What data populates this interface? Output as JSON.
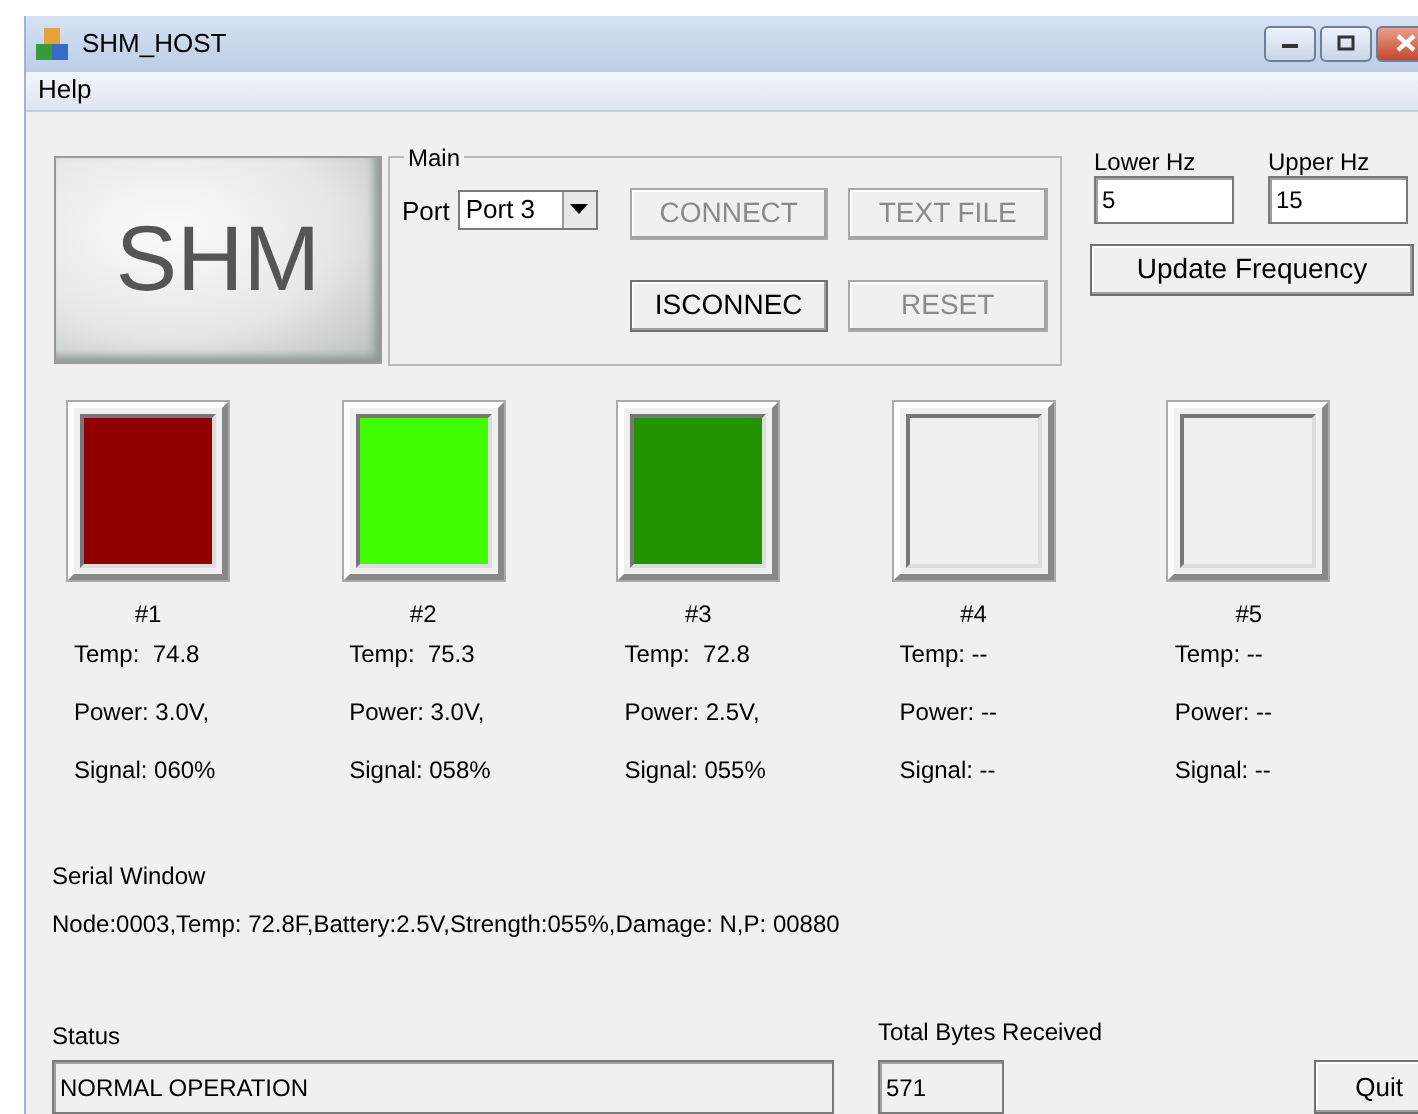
{
  "window": {
    "title": "SHM_HOST"
  },
  "menu": [
    "Help"
  ],
  "logo": "SHM",
  "main": {
    "title": "Main",
    "port_label": "Port",
    "port_value": "Port 3",
    "buttons": [
      {
        "label": "CONNECT",
        "disabled": true
      },
      {
        "label": "TEXT FILE",
        "disabled": true
      },
      {
        "label": "ISCONNEC",
        "disabled": false
      },
      {
        "label": "RESET",
        "disabled": true
      }
    ]
  },
  "frequency": {
    "lower_label": "Lower Hz",
    "lower_value": "5",
    "upper_label": "Upper Hz",
    "upper_value": "15",
    "button": "Update Frequency"
  },
  "nodes": [
    {
      "label": "#1",
      "color": "#900000",
      "temp": "Temp:  74.8",
      "power": "Power: 3.0V,",
      "signal": "Signal: 060%"
    },
    {
      "label": "#2",
      "color": "#40ff00",
      "temp": "Temp:  75.3",
      "power": "Power: 3.0V,",
      "signal": "Signal: 058%"
    },
    {
      "label": "#3",
      "color": "#229400",
      "temp": "Temp:  72.8",
      "power": "Power: 2.5V,",
      "signal": "Signal: 055%"
    },
    {
      "label": "#4",
      "temp": "Temp: --",
      "power": "Power: --",
      "signal": "Signal: --"
    },
    {
      "label": "#5",
      "temp": "Temp: --",
      "power": "Power: --",
      "signal": "Signal: --"
    }
  ],
  "serial": {
    "label": "Serial Window",
    "message": "Node:0003,Temp: 72.8F,Battery:2.5V,Strength:055%,Damage: N,P: 00880"
  },
  "status": {
    "label": "Status",
    "value": "NORMAL OPERATION"
  },
  "bytes": {
    "label": "Total Bytes Received",
    "value": "571"
  },
  "quit": "Quit"
}
